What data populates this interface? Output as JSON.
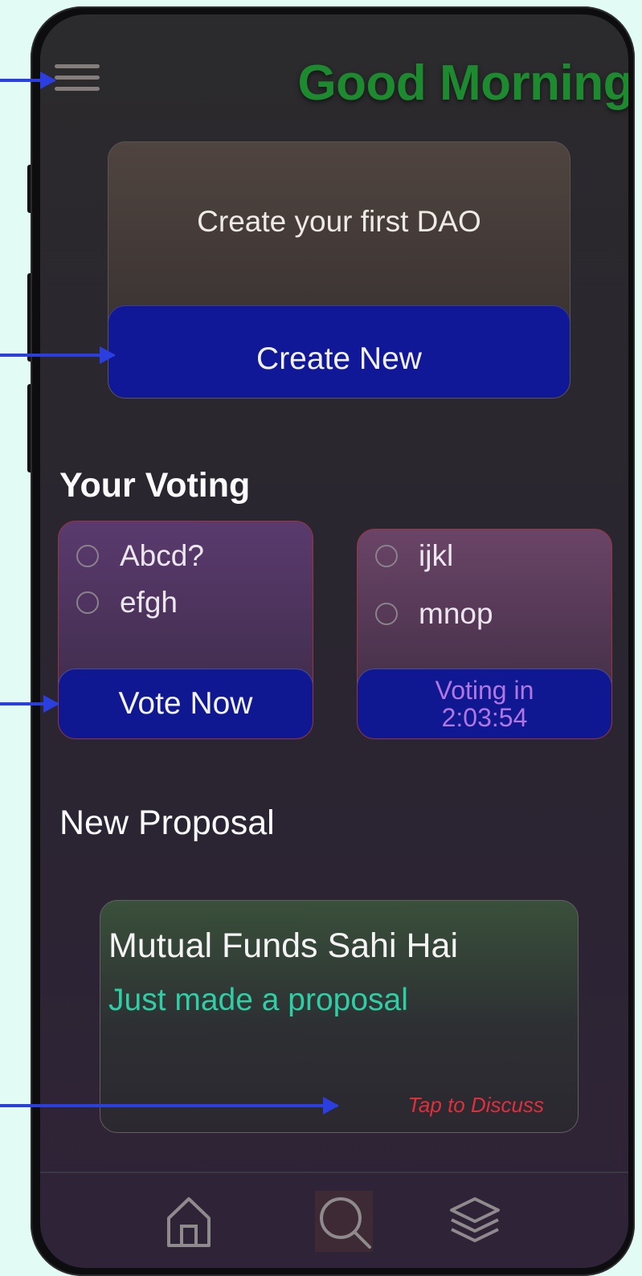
{
  "header": {
    "greeting": "Good Morning"
  },
  "create_card": {
    "title": "Create your first DAO",
    "button_label": "Create New"
  },
  "voting": {
    "section_title": "Your Voting",
    "cards": [
      {
        "options": [
          "Abcd?",
          "efgh"
        ],
        "button_label": "Vote Now"
      },
      {
        "options": [
          "ijkl",
          "mnop"
        ],
        "status_line1": "Voting in",
        "status_line2": "2:03:54"
      }
    ]
  },
  "proposals": {
    "section_title": "New Proposal",
    "items": [
      {
        "title": "Mutual Funds Sahi Hai",
        "subtitle": "Just made a proposal",
        "cta": "Tap to Discuss"
      }
    ]
  },
  "bottom_nav": {
    "icons": [
      "home-icon",
      "search-icon",
      "layers-icon"
    ]
  },
  "colors": {
    "page_background": "#e2fbf4",
    "greeting": "#1d8a30",
    "primary_button": "#101897",
    "timer_text": "#b276e4",
    "proposal_subtitle": "#2ecfa4",
    "cta": "#df2f3c",
    "annotation_arrow": "#2b3ee0"
  }
}
